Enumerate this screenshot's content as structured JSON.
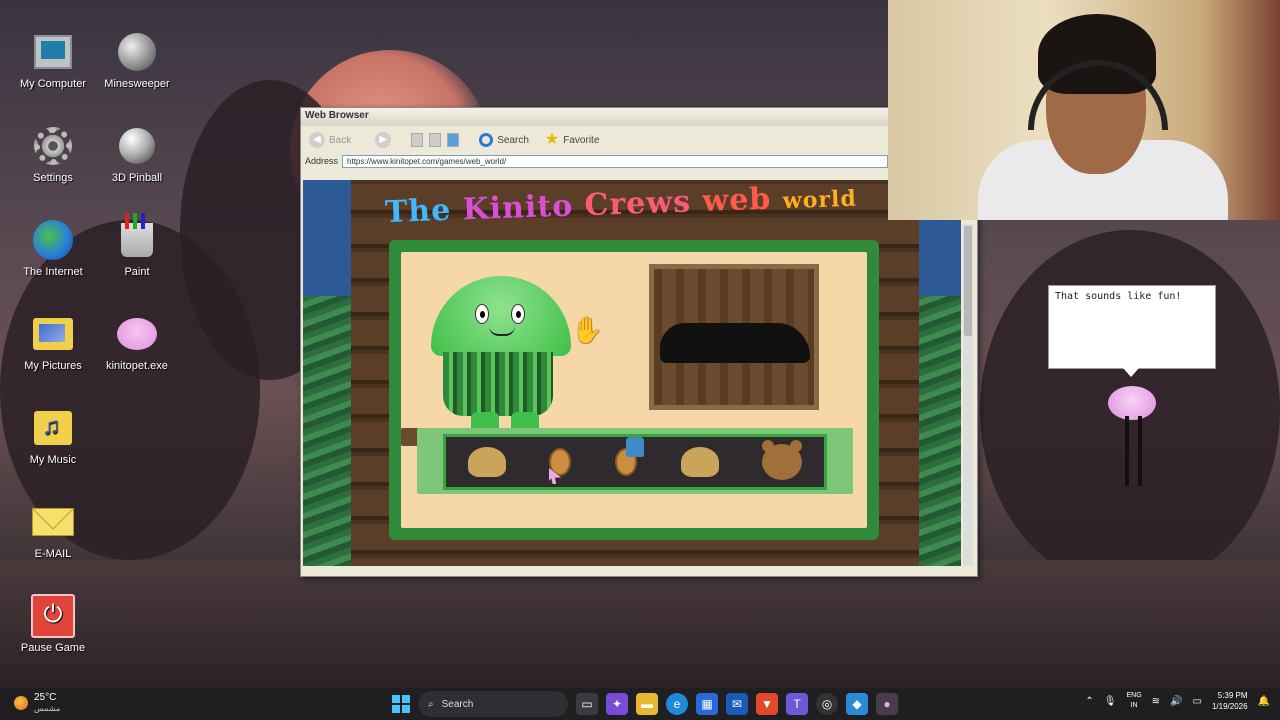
{
  "desktop": {
    "icons": [
      {
        "label": "My Computer"
      },
      {
        "label": "Minesweeper"
      },
      {
        "label": "Settings"
      },
      {
        "label": "3D Pinball"
      },
      {
        "label": "The Internet"
      },
      {
        "label": "Paint"
      },
      {
        "label": "My Pictures"
      },
      {
        "label": "kinitopet.exe"
      },
      {
        "label": "My Music"
      },
      {
        "label": "E-MAIL"
      },
      {
        "label": "Pause Game"
      }
    ]
  },
  "browser": {
    "title": "Web Browser",
    "toolbar": {
      "back_label": "Back",
      "search_label": "Search",
      "favorite_label": "Favorite"
    },
    "address_label": "Address",
    "address_value": "https://www.kinitopet.com/games/web_world/",
    "site": {
      "title_the": "The",
      "title_kinito": "Kinito",
      "title_crews": "Crews",
      "title_web": "web",
      "title_world": "world"
    }
  },
  "kinito": {
    "speech": "That sounds like fun!"
  },
  "taskbar": {
    "weather_temp": "25°C",
    "weather_desc": "مشمس",
    "search_label": "Search",
    "lang_top": "ENG",
    "lang_bottom": "IN",
    "time": "5:39 PM",
    "date": "1/19/2026"
  },
  "colors": {
    "window_bg": "#ece9d8",
    "leaf_green": "#2f8a3a",
    "taskbar": "#1f1f22",
    "accent_blue": "#4cc2ff"
  }
}
